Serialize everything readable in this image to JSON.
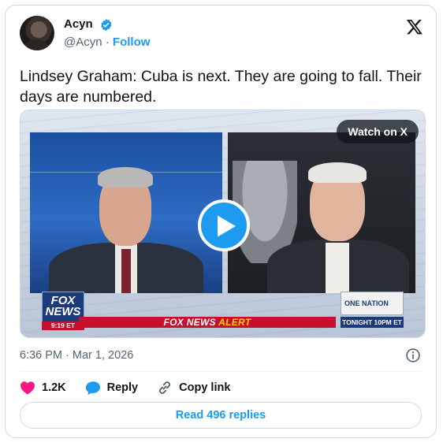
{
  "author": {
    "name": "Acyn",
    "handle": "@Acyn",
    "separator": "·",
    "follow_label": "Follow",
    "verified_color": "#1d9bf0"
  },
  "tweet": {
    "text": "Lindsey Graham: Cuba is next. They are going to fall. Their days are numbered."
  },
  "media": {
    "watch_label": "Watch on X",
    "chyron_prefix": "FOX NEWS",
    "chyron_alert": "ALERT",
    "logo_line1": "FOX",
    "logo_line2": "NEWS",
    "logo_time": "9:19 ET",
    "promo_title": "ONE NATION",
    "promo_time": "TONIGHT 10PM ET",
    "play_icon": "play-icon"
  },
  "meta": {
    "timestamp": "6:36 PM · Mar 1, 2026"
  },
  "actions": {
    "likes": "1.2K",
    "reply_label": "Reply",
    "copy_label": "Copy link"
  },
  "replies_button": "Read 496 replies",
  "colors": {
    "accent": "#1d9bf0",
    "like": "#f91880",
    "text": "#0f1419",
    "muted": "#536471"
  }
}
